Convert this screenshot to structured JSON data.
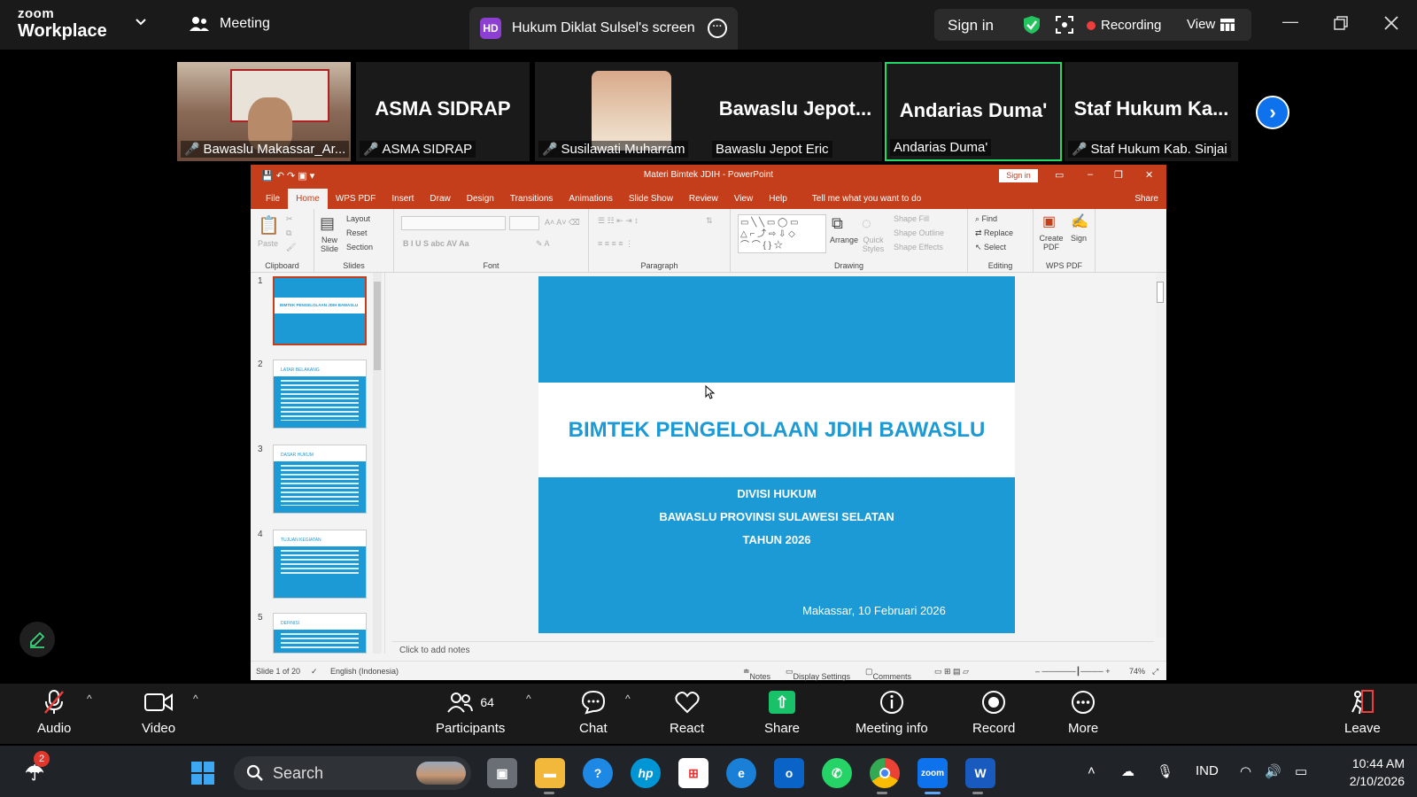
{
  "zoom": {
    "logo_top": "zoom",
    "logo_bottom": "Workplace",
    "meeting_label": "Meeting",
    "screen_share": {
      "initials": "HD",
      "label": "Hukum Diklat Sulsel's screen"
    },
    "sign_in": "Sign in",
    "recording": "Recording",
    "view": "View"
  },
  "gallery": [
    {
      "name": "Bawaslu Makassar_Ar...",
      "big": ""
    },
    {
      "name": "ASMA SIDRAP",
      "big": "ASMA SIDRAP"
    },
    {
      "name": "Susilawati Muharram",
      "big": ""
    },
    {
      "name": "Bawaslu Jepot Eric",
      "big": "Bawaslu  Jepot..."
    },
    {
      "name": "Andarias Duma'",
      "big": "Andarias Duma'"
    },
    {
      "name": "Staf Hukum Kab. Sinjai",
      "big": "Staf  Hukum  Ka..."
    }
  ],
  "ppt": {
    "title": "Materi Bimtek JDIH - PowerPoint",
    "sign_in": "Sign in",
    "tabs": [
      "File",
      "Home",
      "WPS PDF",
      "Insert",
      "Draw",
      "Design",
      "Transitions",
      "Animations",
      "Slide Show",
      "Review",
      "View",
      "Help"
    ],
    "tell_me": "Tell me what you want to do",
    "share": "Share",
    "ribbon": {
      "clipboard": "Clipboard",
      "paste": "Paste",
      "slides": "Slides",
      "new_slide": "New Slide",
      "layout": "Layout",
      "reset": "Reset",
      "section": "Section",
      "font": "Font",
      "paragraph": "Paragraph",
      "drawing": "Drawing",
      "arrange": "Arrange",
      "quick_styles": "Quick Styles",
      "shape_fill": "Shape Fill",
      "shape_outline": "Shape Outline",
      "shape_effects": "Shape Effects",
      "editing": "Editing",
      "find": "Find",
      "replace": "Replace",
      "select": "Select",
      "wps_pdf": "WPS PDF",
      "create_pdf": "Create PDF",
      "sign": "Sign"
    },
    "thumbnails": [
      {
        "num": "1",
        "title": "BIMTEK PENGELOLAAN JDIH BAWASLU"
      },
      {
        "num": "2",
        "title": "LATAR BELAKANG"
      },
      {
        "num": "3",
        "title": "DASAR HUKUM"
      },
      {
        "num": "4",
        "title": "TUJUAN KEGIATAN"
      },
      {
        "num": "5",
        "title": "DEFINISI"
      }
    ],
    "slide": {
      "title": "BIMTEK PENGELOLAAN JDIH BAWASLU",
      "line1": "DIVISI HUKUM",
      "line2": "BAWASLU PROVINSI SULAWESI SELATAN",
      "line3": "TAHUN 2026",
      "place_date": "Makassar, 10 Februari 2026"
    },
    "notes_placeholder": "Click to add notes",
    "status": {
      "slide_count": "Slide 1 of 20",
      "language": "English (Indonesia)",
      "notes": "Notes",
      "display_settings": "Display Settings",
      "comments": "Comments",
      "zoom": "74%"
    }
  },
  "toolbar": {
    "audio": "Audio",
    "video": "Video",
    "participants": "Participants",
    "participant_count": "64",
    "chat": "Chat",
    "react": "React",
    "share": "Share",
    "meeting_info": "Meeting info",
    "record": "Record",
    "more": "More",
    "leave": "Leave"
  },
  "taskbar": {
    "search_placeholder": "Search",
    "weather_badge": "2",
    "language": "IND",
    "time": "10:44 AM",
    "date": "2/10/2026"
  },
  "colors": {
    "ppt_accent": "#c43e1c",
    "slide_blue": "#1c9ad6",
    "recording_red": "#ee3d3d",
    "active_speaker": "#23d968",
    "share_green": "#19c168",
    "zoom_blue": "#0e72ed"
  }
}
